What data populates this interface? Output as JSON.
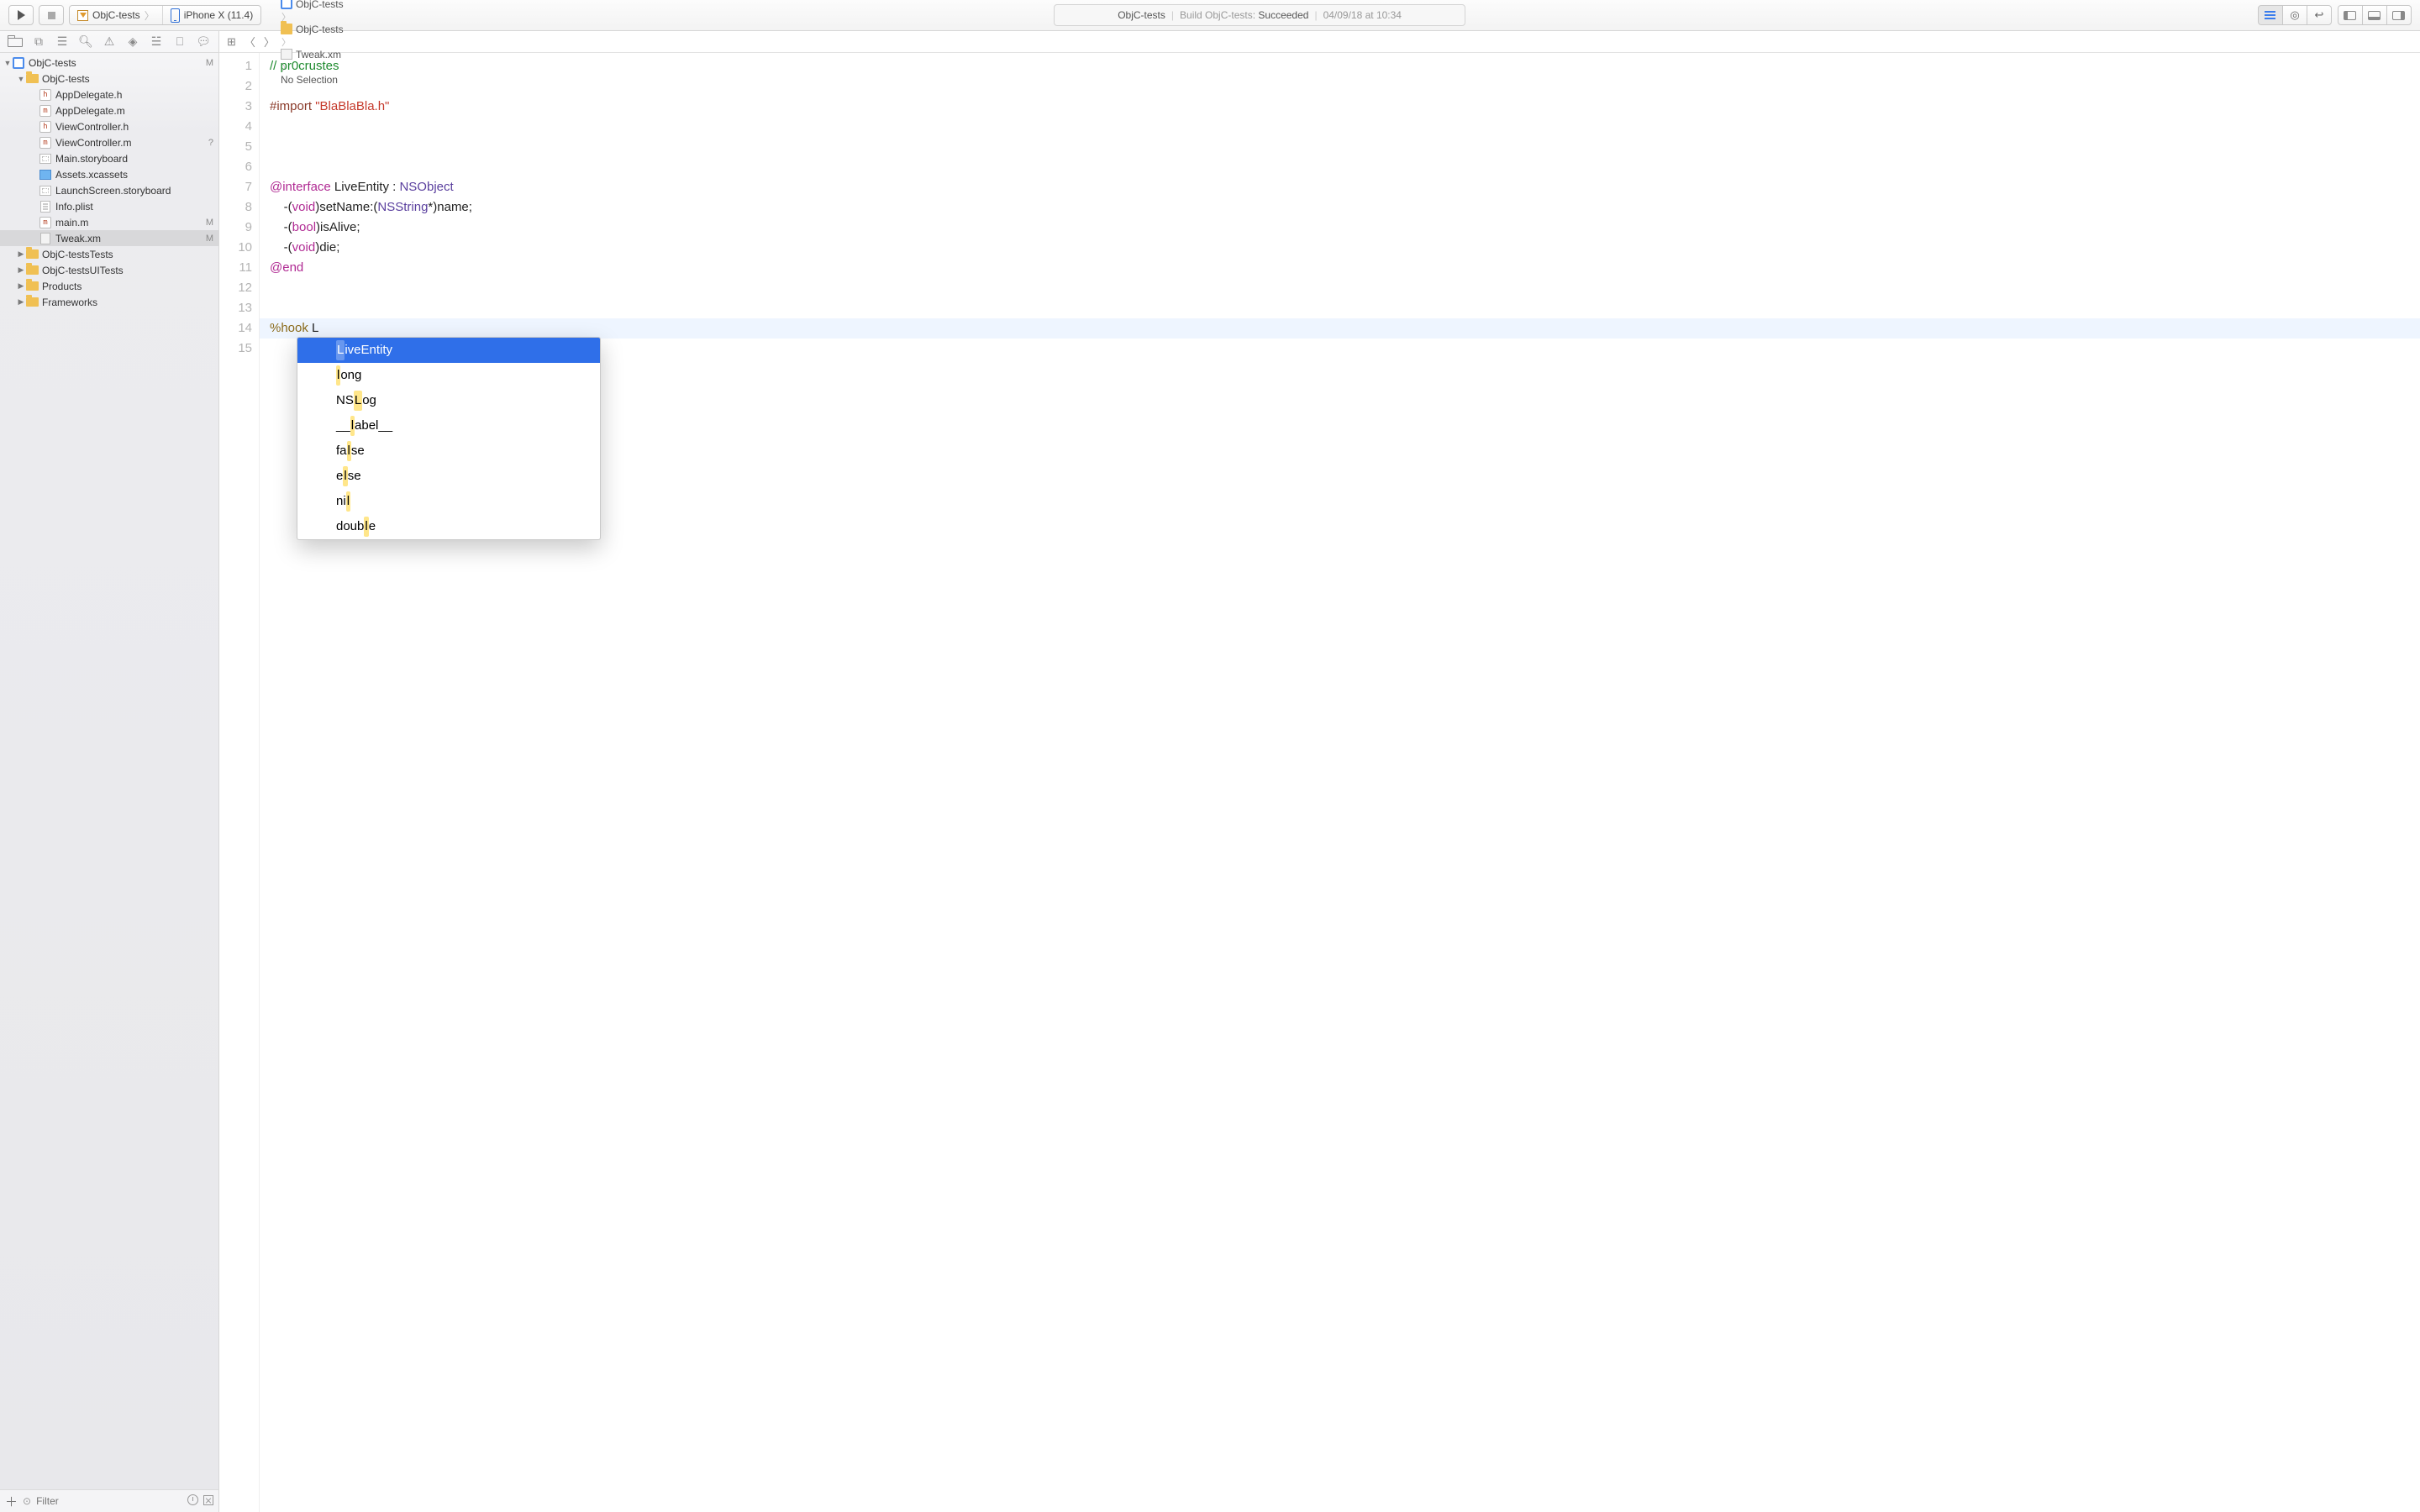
{
  "toolbar": {
    "scheme_target": "ObjC-tests",
    "scheme_device": "iPhone X (11.4)",
    "status_project": "ObjC-tests",
    "status_activity": "Build ObjC-tests:",
    "status_result": "Succeeded",
    "status_time": "04/09/18 at 10:34"
  },
  "navigator": {
    "filter_placeholder": "Filter",
    "tree": [
      {
        "depth": 0,
        "icon": "proj",
        "label": "ObjC-tests",
        "disclosure": "down",
        "badge": "M"
      },
      {
        "depth": 1,
        "icon": "fold",
        "label": "ObjC-tests",
        "disclosure": "down",
        "badge": ""
      },
      {
        "depth": 2,
        "icon": "h",
        "label": "AppDelegate.h",
        "disclosure": "",
        "badge": ""
      },
      {
        "depth": 2,
        "icon": "m",
        "label": "AppDelegate.m",
        "disclosure": "",
        "badge": ""
      },
      {
        "depth": 2,
        "icon": "h",
        "label": "ViewController.h",
        "disclosure": "",
        "badge": ""
      },
      {
        "depth": 2,
        "icon": "m",
        "label": "ViewController.m",
        "disclosure": "",
        "badge": "?"
      },
      {
        "depth": 2,
        "icon": "sb",
        "label": "Main.storyboard",
        "disclosure": "",
        "badge": ""
      },
      {
        "depth": 2,
        "icon": "xc",
        "label": "Assets.xcassets",
        "disclosure": "",
        "badge": ""
      },
      {
        "depth": 2,
        "icon": "sb",
        "label": "LaunchScreen.storyboard",
        "disclosure": "",
        "badge": ""
      },
      {
        "depth": 2,
        "icon": "pl",
        "label": "Info.plist",
        "disclosure": "",
        "badge": ""
      },
      {
        "depth": 2,
        "icon": "m",
        "label": "main.m",
        "disclosure": "",
        "badge": "M"
      },
      {
        "depth": 2,
        "icon": "xm",
        "label": "Tweak.xm",
        "disclosure": "",
        "badge": "M",
        "selected": true
      },
      {
        "depth": 1,
        "icon": "fold",
        "label": "ObjC-testsTests",
        "disclosure": "right",
        "badge": ""
      },
      {
        "depth": 1,
        "icon": "fold",
        "label": "ObjC-testsUITests",
        "disclosure": "right",
        "badge": ""
      },
      {
        "depth": 1,
        "icon": "fold",
        "label": "Products",
        "disclosure": "right",
        "badge": ""
      },
      {
        "depth": 1,
        "icon": "fold",
        "label": "Frameworks",
        "disclosure": "right",
        "badge": ""
      }
    ]
  },
  "jumpbar": {
    "segments": [
      {
        "icon": "proj",
        "label": "ObjC-tests"
      },
      {
        "icon": "fold",
        "label": "ObjC-tests"
      },
      {
        "icon": "xm",
        "label": "Tweak.xm"
      },
      {
        "icon": "",
        "label": "No Selection"
      }
    ]
  },
  "code": {
    "lines": [
      {
        "n": 1,
        "html": "<span class='tok-cmt'>// pr0crustes</span>"
      },
      {
        "n": 2,
        "html": ""
      },
      {
        "n": 3,
        "html": "<span class='tok-pp'>#import </span><span class='tok-str'>\"BlaBlaBla.h\"</span>"
      },
      {
        "n": 4,
        "html": ""
      },
      {
        "n": 5,
        "html": ""
      },
      {
        "n": 6,
        "html": ""
      },
      {
        "n": 7,
        "html": "<span class='tok-kw'>@interface</span> LiveEntity : <span class='tok-type'>NSObject</span>"
      },
      {
        "n": 8,
        "html": "    -(<span class='tok-kw'>void</span>)setName:(<span class='tok-type'>NSString</span>*)name;"
      },
      {
        "n": 9,
        "html": "    -(<span class='tok-kw'>bool</span>)isAlive;"
      },
      {
        "n": 10,
        "html": "    -(<span class='tok-kw'>void</span>)die;"
      },
      {
        "n": 11,
        "html": "<span class='tok-kw'>@end</span>"
      },
      {
        "n": 12,
        "html": ""
      },
      {
        "n": 13,
        "html": ""
      },
      {
        "n": 14,
        "html": "<span class='tok-dir'>%hook</span> L",
        "highlight": true
      },
      {
        "n": 15,
        "html": ""
      }
    ]
  },
  "autocomplete": {
    "items": [
      {
        "pre": "",
        "mark": "L",
        "post": "iveEntity",
        "selected": true
      },
      {
        "pre": "",
        "mark": "l",
        "post": "ong"
      },
      {
        "pre": "NS",
        "mark": "L",
        "post": "og"
      },
      {
        "pre": "__",
        "mark": "l",
        "post": "abel__"
      },
      {
        "pre": "fa",
        "mark": "l",
        "post": "se"
      },
      {
        "pre": "e",
        "mark": "l",
        "post": "se"
      },
      {
        "pre": "ni",
        "mark": "l",
        "post": ""
      },
      {
        "pre": "doub",
        "mark": "l",
        "post": "e"
      }
    ]
  }
}
